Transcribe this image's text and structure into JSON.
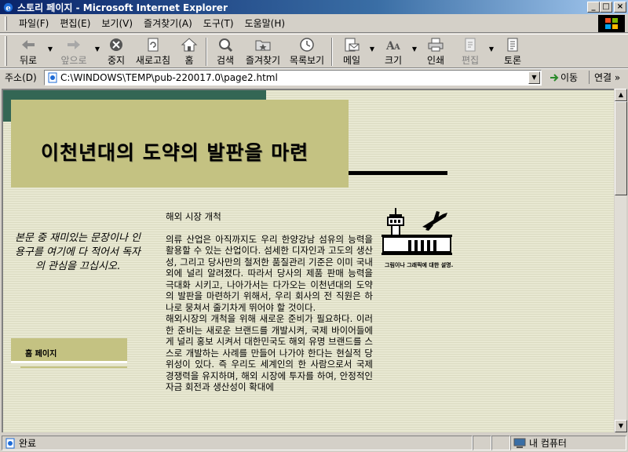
{
  "window": {
    "title": "스토리 페이지 - Microsoft Internet Explorer",
    "buttons": {
      "minimize": "_",
      "maximize": "□",
      "close": "×"
    }
  },
  "menu": [
    "파일(F)",
    "편집(E)",
    "보기(V)",
    "즐겨찾기(A)",
    "도구(T)",
    "도움말(H)"
  ],
  "toolbar": {
    "back": "뒤로",
    "forward": "앞으로",
    "stop": "중지",
    "refresh": "새로고침",
    "home": "홈",
    "search": "검색",
    "favorites": "즐겨찾기",
    "history": "목록보기",
    "mail": "메일",
    "size": "크기",
    "print": "인쇄",
    "edit": "편집",
    "discuss": "토론"
  },
  "address": {
    "label": "주소(D)",
    "url": "C:\\WINDOWS\\TEMP\\pub-220017.0\\page2.html",
    "go": "이동",
    "links": "연결 »"
  },
  "page": {
    "heading": "이천년대의 도약의 발판을 마련",
    "pull_quote": "본문 중 재미있는 문장이나 인용구를 여기에 다 적어서 독자의 관심을 끄십시오.",
    "nav_label": "홈 페이지",
    "subheading": "해외 시장 개척",
    "paragraph1": "의류 산업은 아직까지도 우리 한양강남 섬유의 능력을 활용할 수 있는 산업이다. 섬세한 디자인과 고도의 생산성, 그리고 당사만의 철저한 품질관리 기준은 이미 국내외에 널리 알려졌다. 따라서 당사의 제품 판매 능력을 극대화 시키고, 나아가서는 다가오는 이천년대의 도약의 발판을 마련하기 위해서, 우리 회사의 전 직원은 하나로 뭉쳐서 줄기차게 뛰어야 할 것이다.",
    "paragraph2": "해외시장의 개척을 위해 새로운 준비가 필요하다. 이러한 준비는 새로운 브랜드를 개발시켜, 국제 바이어들에게 널리 홍보 시켜서 대한민국도 해외 유명 브랜드를 스스로 개발하는 사례를 만들어 나가야 한다는 현실적 당위성이 있다. 즉 우리도 세계인의 한 사람으로서 국제 경쟁력을 유지하며, 해외 시장에 투자를 하여, 안정적인 자금 회전과 생산성이 확대에",
    "caption": "그림이나 그래픽에 대한 설명."
  },
  "status": {
    "text": "완료",
    "zone": "내 컴퓨터"
  },
  "colors": {
    "accent_dark": "#336654",
    "accent_khaki": "#c4c282",
    "page_bg": "#e8e8d2"
  }
}
